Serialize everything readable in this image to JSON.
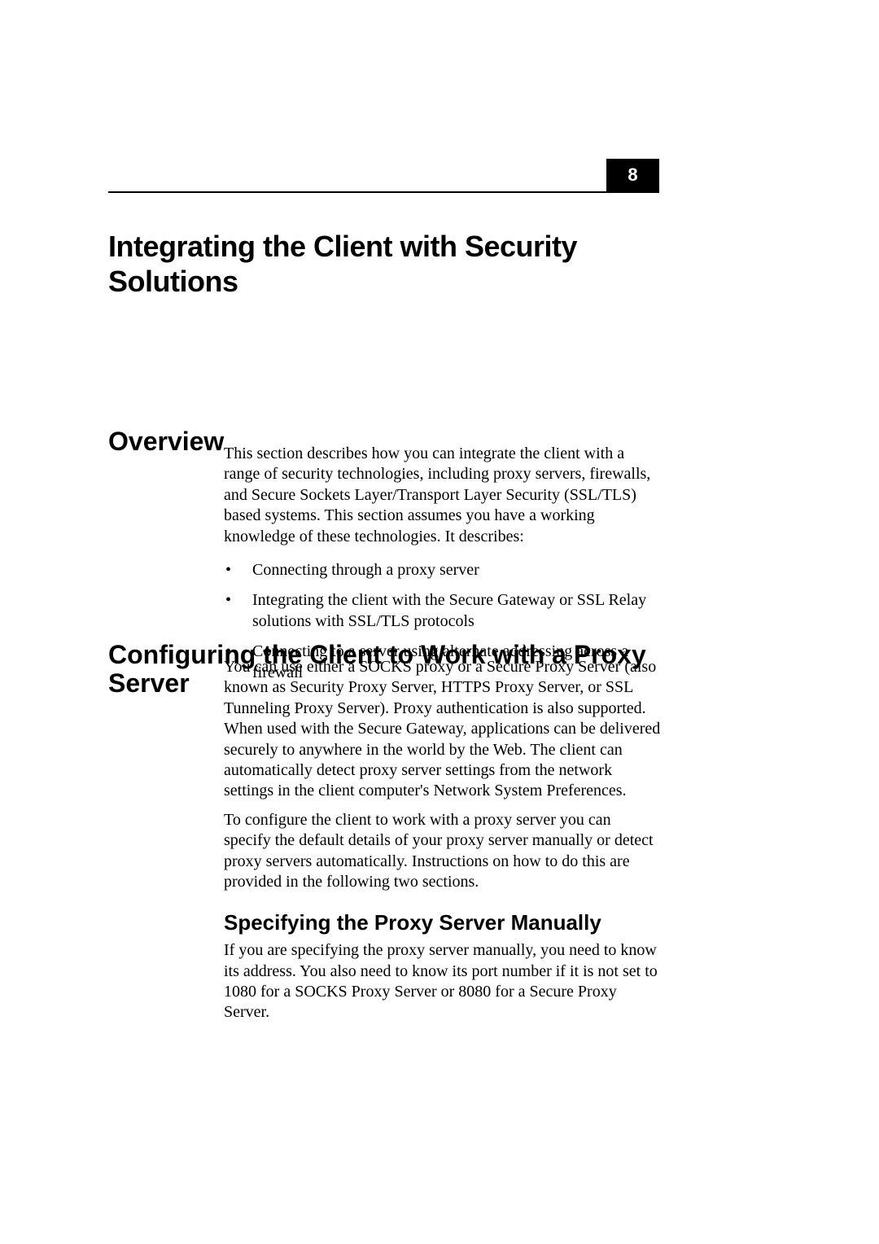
{
  "chapter": {
    "number": "8",
    "title": "Integrating the Client with Security Solutions"
  },
  "overview": {
    "heading": "Overview",
    "intro": "This section describes how you can integrate the client with a range of security technologies, including proxy servers, firewalls, and Secure Sockets Layer/Transport Layer Security (SSL/TLS) based systems. This section assumes you have a working knowledge of these technologies. It describes:",
    "bullets": [
      "Connecting through a proxy server",
      "Integrating the client with the Secure Gateway or SSL Relay solutions with SSL/TLS protocols",
      "Connecting to a server using alternate addressing across a firewall"
    ]
  },
  "config": {
    "heading": "Configuring the Client to Work with a Proxy Server",
    "para1": "You can use either a SOCKS proxy or a Secure Proxy Server (also known as Security Proxy Server, HTTPS Proxy Server, or SSL Tunneling Proxy Server). Proxy authentication is also supported. When used with the Secure Gateway, applications can be delivered securely to anywhere in the world by the Web. The client can automatically detect proxy server settings from the network settings in the client computer's Network System Preferences.",
    "para2": "To configure the client to work with a proxy server you can specify the default details of your proxy server manually or detect proxy servers automatically. Instructions on how to do this are provided in the following two sections.",
    "sub": {
      "heading": "Specifying the Proxy Server Manually",
      "para": "If you are specifying the proxy server manually, you need to know its address. You also need to know its port number if it is not set to 1080 for a SOCKS Proxy Server or 8080 for a Secure Proxy Server."
    }
  }
}
